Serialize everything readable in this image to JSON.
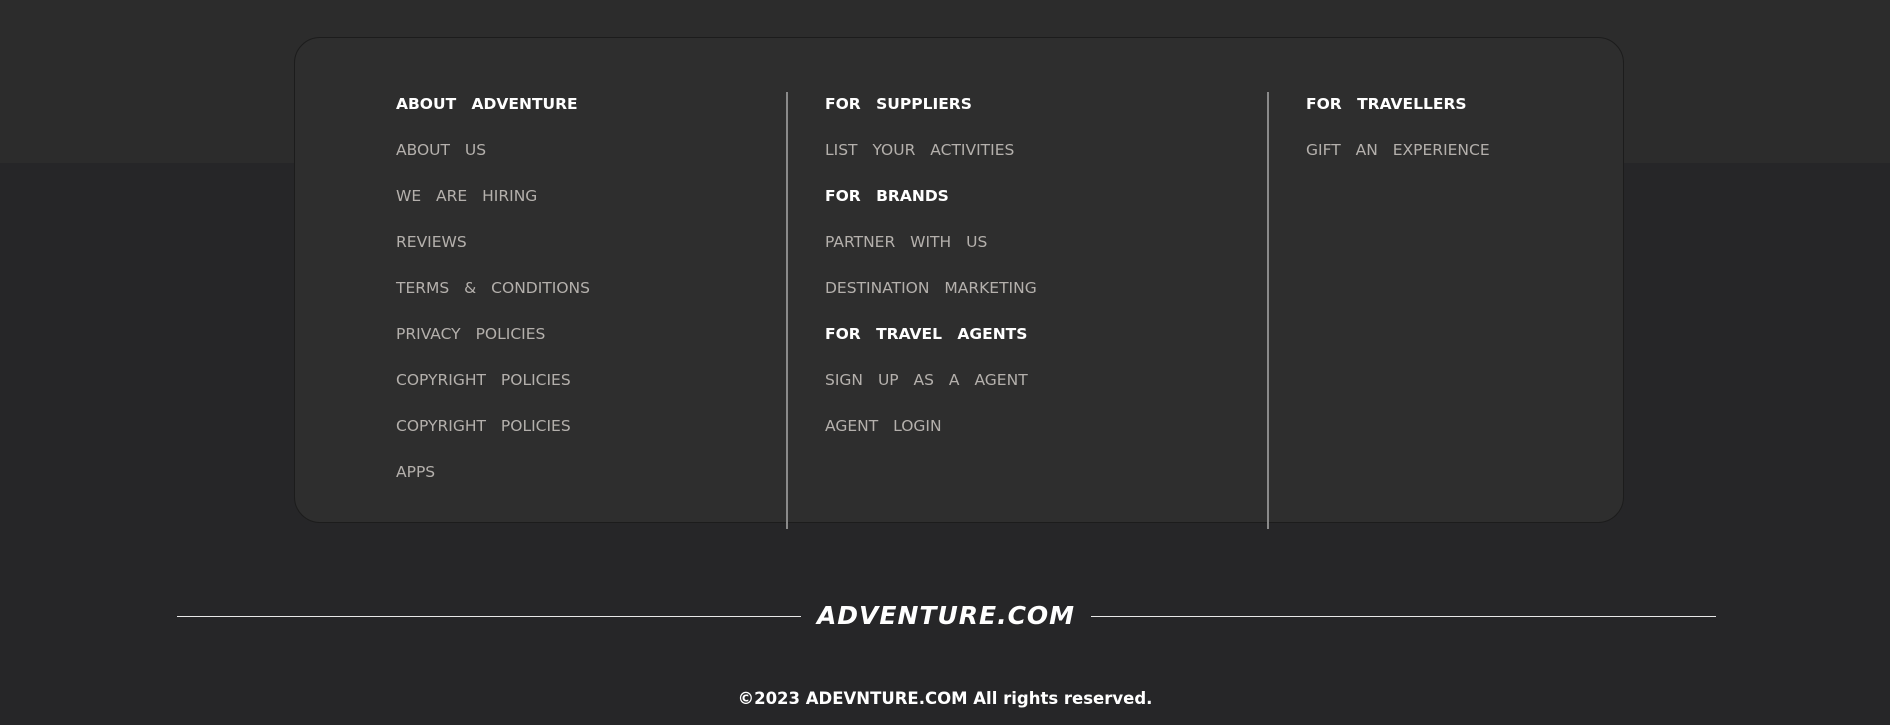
{
  "colors": {
    "page_background": "#262628",
    "top_band": "#2c2c2c",
    "card_background": "#2e2e2e",
    "heading_text": "#ffffff",
    "link_text": "#b4b0ac",
    "divider": "#8a8a8a"
  },
  "footer": {
    "columns": [
      {
        "items": [
          {
            "label": "ABOUT ADVENTURE",
            "kind": "heading"
          },
          {
            "label": "ABOUT US",
            "kind": "link"
          },
          {
            "label": "WE ARE HIRING",
            "kind": "link"
          },
          {
            "label": "REVIEWS",
            "kind": "link"
          },
          {
            "label": "TERMS & CONDITIONS",
            "kind": "link"
          },
          {
            "label": "PRIVACY POLICIES",
            "kind": "link"
          },
          {
            "label": "COPYRIGHT POLICIES",
            "kind": "link"
          },
          {
            "label": "COPYRIGHT POLICIES",
            "kind": "link"
          },
          {
            "label": "APPS",
            "kind": "link"
          }
        ]
      },
      {
        "items": [
          {
            "label": "FOR SUPPLIERS",
            "kind": "heading"
          },
          {
            "label": "LIST YOUR ACTIVITIES",
            "kind": "link"
          },
          {
            "label": "FOR BRANDS",
            "kind": "heading"
          },
          {
            "label": "PARTNER WITH US",
            "kind": "link"
          },
          {
            "label": "DESTINATION MARKETING",
            "kind": "link"
          },
          {
            "label": "FOR TRAVEL AGENTS",
            "kind": "heading"
          },
          {
            "label": "SIGN UP AS A AGENT",
            "kind": "link"
          },
          {
            "label": "AGENT LOGIN",
            "kind": "link"
          }
        ]
      },
      {
        "items": [
          {
            "label": "FOR TRAVELLERS",
            "kind": "heading"
          },
          {
            "label": "GIFT AN EXPERIENCE",
            "kind": "link"
          }
        ]
      }
    ],
    "brand": "ADVENTURE.COM",
    "copyright": "©2023 ADEVNTURE.COM All rights reserved."
  }
}
